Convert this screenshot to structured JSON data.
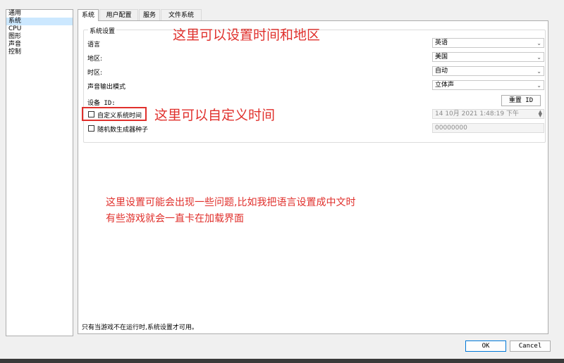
{
  "sidebar": {
    "items": [
      {
        "label": "通用",
        "selected": false
      },
      {
        "label": "系统",
        "selected": true
      },
      {
        "label": "CPU",
        "selected": false
      },
      {
        "label": "图形",
        "selected": false
      },
      {
        "label": "声音",
        "selected": false
      },
      {
        "label": "控制",
        "selected": false
      }
    ]
  },
  "tabs": [
    {
      "label": "系统",
      "selected": true
    },
    {
      "label": "用户配置",
      "selected": false
    },
    {
      "label": "服务",
      "selected": false
    },
    {
      "label": "文件系统",
      "selected": false
    }
  ],
  "system_settings": {
    "group_title": "系统设置",
    "language": {
      "label": "语言",
      "value": "英语"
    },
    "region": {
      "label": "地区:",
      "value": "美国"
    },
    "timezone": {
      "label": "时区:",
      "value": "自动"
    },
    "sound_output": {
      "label": "声音输出模式",
      "value": "立体声"
    },
    "device_id": {
      "label": "设备 ID:",
      "reset_button": "重置 ID"
    },
    "custom_time": {
      "label": "自定义系统时间",
      "checked": false,
      "value": "14 10月 2021 1:48:19 下午"
    },
    "rng_seed": {
      "label": "随机数生成器种子",
      "checked": false,
      "value": "00000000"
    }
  },
  "footer_note": "只有当游戏不在运行时,系统设置才可用。",
  "buttons": {
    "ok": "OK",
    "cancel": "Cancel"
  },
  "annotations": {
    "region_note": "这里可以设置时间和地区",
    "custom_time_note": "这里可以自定义时间",
    "warning_line1": "这里设置可能会出现一些问题,比如我把语言设置成中文时",
    "warning_line2": "有些游戏就会一直卡在加载界面"
  },
  "colors": {
    "annotation": "#e0302c",
    "selection": "#cce8ff"
  }
}
